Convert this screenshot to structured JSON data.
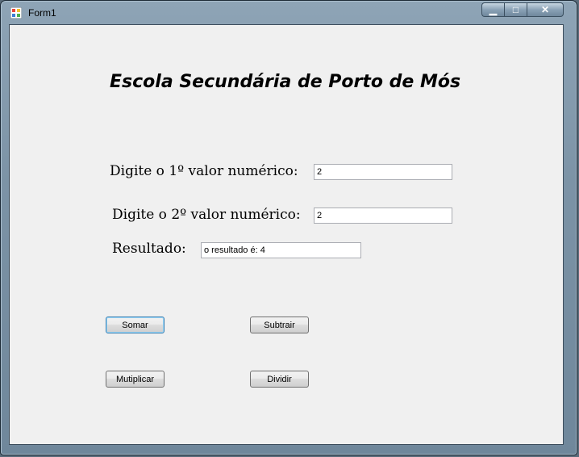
{
  "window": {
    "title": "Form1"
  },
  "controls": {
    "minimize": "▁",
    "maximize": "□",
    "close": "✕"
  },
  "form": {
    "heading": "Escola Secundária de Porto de Mós",
    "label1": "Digite o 1º valor numérico:",
    "value1": "2",
    "label2": "Digite o 2º valor numérico:",
    "value2": "2",
    "result_label": "Resultado:",
    "result_value": "o resultado é: 4"
  },
  "buttons": {
    "add": "Somar",
    "subtract": "Subtrair",
    "multiply": "Mutiplicar",
    "divide": "Dividir"
  },
  "icons": {
    "app": "winforms-app-icon"
  }
}
